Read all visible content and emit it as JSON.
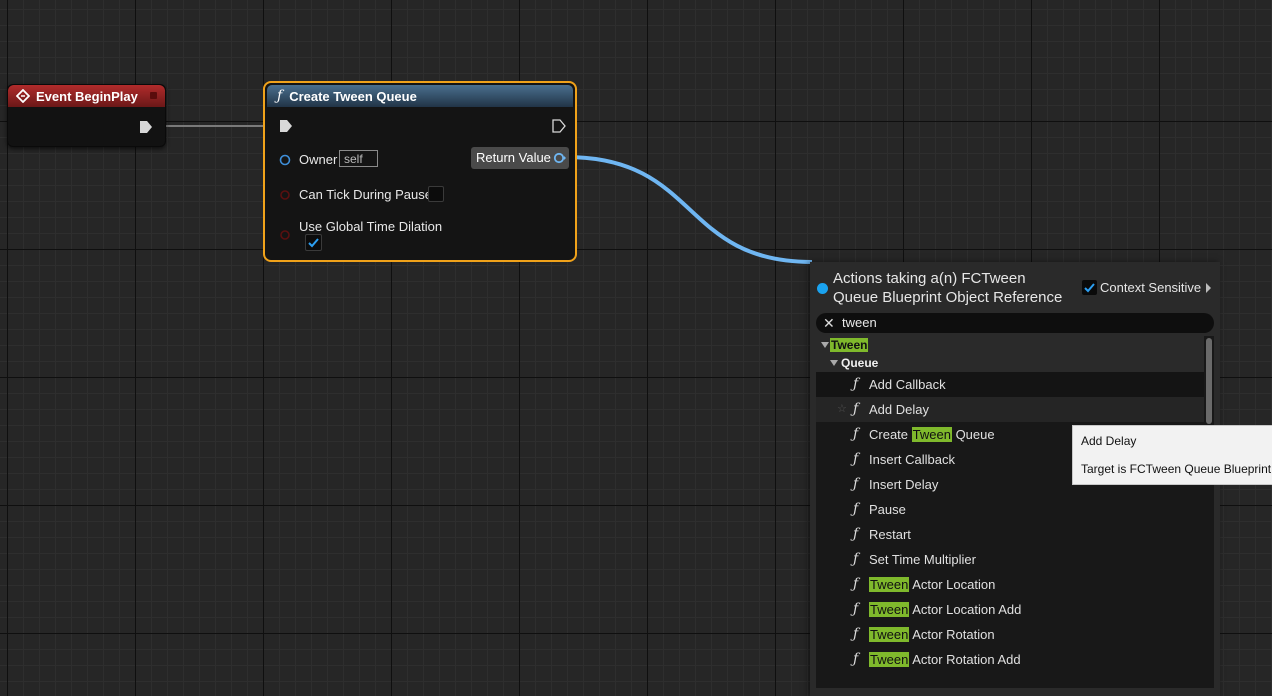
{
  "event_node": {
    "title": "Event BeginPlay",
    "header_color": "#b12b2b"
  },
  "function_node": {
    "title": "Create Tween Queue",
    "icon": "function-icon",
    "border_color": "#f0a21a",
    "pins": {
      "owner_label": "Owner",
      "owner_value": "self",
      "can_tick_label": "Can Tick During Pause",
      "can_tick_checked": false,
      "use_global_label": "Use Global Time Dilation",
      "use_global_checked": true,
      "return_label": "Return Value"
    }
  },
  "action_menu": {
    "title_line1": "Actions taking a(n) FCTween",
    "title_line2": "Queue Blueprint Object Reference",
    "context_sensitive_label": "Context Sensitive",
    "context_sensitive_checked": true,
    "search_value": "tween",
    "category": "Tween",
    "subcategory": "Queue",
    "items": [
      {
        "pre": "",
        "hl": "",
        "post": "Add Callback"
      },
      {
        "pre": "",
        "hl": "",
        "post": "Add Delay"
      },
      {
        "pre": "Create ",
        "hl": "Tween",
        "post": " Queue"
      },
      {
        "pre": "",
        "hl": "",
        "post": "Insert Callback"
      },
      {
        "pre": "",
        "hl": "",
        "post": "Insert Delay"
      },
      {
        "pre": "",
        "hl": "",
        "post": "Pause"
      },
      {
        "pre": "",
        "hl": "",
        "post": "Restart"
      },
      {
        "pre": "",
        "hl": "",
        "post": "Set Time Multiplier"
      },
      {
        "pre": "",
        "hl": "Tween",
        "post": " Actor Location"
      },
      {
        "pre": "",
        "hl": "Tween",
        "post": " Actor Location Add"
      },
      {
        "pre": "",
        "hl": "Tween",
        "post": " Actor Rotation"
      },
      {
        "pre": "",
        "hl": "Tween",
        "post": " Actor Rotation Add"
      }
    ]
  },
  "tooltip": {
    "title": "Add Delay",
    "description": "Target is FCTween Queue Blueprint"
  },
  "colors": {
    "highlight": "#7fb92c",
    "wire_object": "#6fb6f2"
  }
}
